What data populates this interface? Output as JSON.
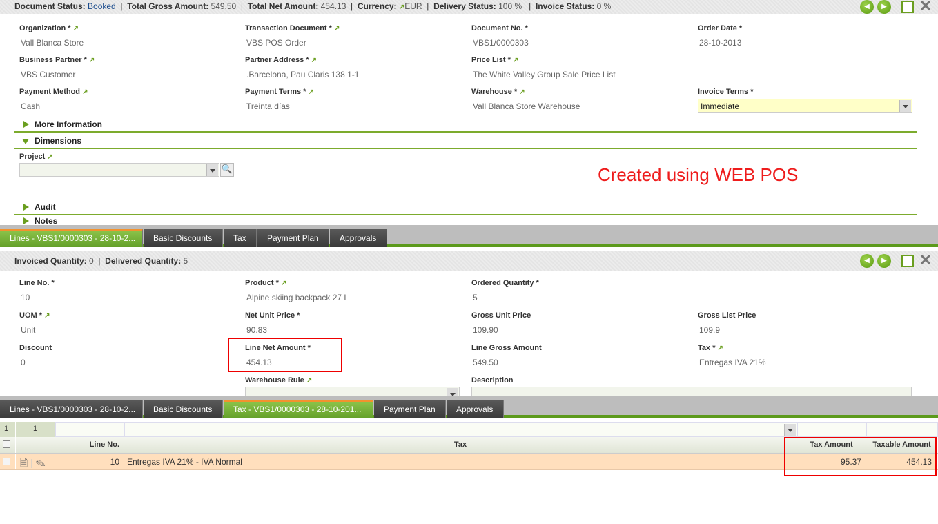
{
  "header": {
    "document_status_label": "Document Status:",
    "document_status": "Booked",
    "total_gross_label": "Total Gross Amount:",
    "total_gross": "549.50",
    "total_net_label": "Total Net Amount:",
    "total_net": "454.13",
    "currency_label": "Currency:",
    "currency": "EUR",
    "delivery_label": "Delivery Status:",
    "delivery": "100 %",
    "invoice_label": "Invoice Status:",
    "invoice": "0 %"
  },
  "form": {
    "organization": {
      "label": "Organization *",
      "value": "Vall Blanca Store"
    },
    "transaction_document": {
      "label": "Transaction Document *",
      "value": "VBS POS Order"
    },
    "document_no": {
      "label": "Document No. *",
      "value": "VBS1/0000303"
    },
    "order_date": {
      "label": "Order Date *",
      "value": "28-10-2013"
    },
    "business_partner": {
      "label": "Business Partner *",
      "value": "VBS Customer"
    },
    "partner_address": {
      "label": "Partner Address *",
      "value": ".Barcelona, Pau Claris 138 1-1"
    },
    "price_list": {
      "label": "Price List *",
      "value": "The White Valley Group Sale Price List"
    },
    "payment_method": {
      "label": "Payment Method",
      "value": "Cash"
    },
    "payment_terms": {
      "label": "Payment Terms *",
      "value": "Treinta días"
    },
    "warehouse": {
      "label": "Warehouse *",
      "value": "Vall Blanca Store Warehouse"
    },
    "invoice_terms": {
      "label": "Invoice Terms *",
      "value": "Immediate"
    },
    "project": {
      "label": "Project",
      "value": ""
    }
  },
  "sections": {
    "more_info": "More Information",
    "dimensions": "Dimensions",
    "audit": "Audit",
    "notes": "Notes"
  },
  "annotation": "Created using WEB POS",
  "tabs1": [
    "Lines - VBS1/0000303 - 28-10-2...",
    "Basic Discounts",
    "Tax",
    "Payment Plan",
    "Approvals"
  ],
  "lines_status": {
    "invoiced_label": "Invoiced Quantity:",
    "invoiced": "0",
    "delivered_label": "Delivered Quantity:",
    "delivered": "5"
  },
  "line": {
    "line_no": {
      "label": "Line No. *",
      "value": "10"
    },
    "product": {
      "label": "Product *",
      "value": "Alpine skiing backpack 27 L"
    },
    "ordered_qty": {
      "label": "Ordered Quantity *",
      "value": "5"
    },
    "uom": {
      "label": "UOM *",
      "value": "Unit"
    },
    "net_unit_price": {
      "label": "Net Unit Price *",
      "value": "90.83"
    },
    "gross_unit_price": {
      "label": "Gross Unit Price",
      "value": "109.90"
    },
    "gross_list_price": {
      "label": "Gross List Price",
      "value": "109.9"
    },
    "discount": {
      "label": "Discount",
      "value": "0"
    },
    "line_net_amount": {
      "label": "Line Net Amount *",
      "value": "454.13"
    },
    "line_gross_amount": {
      "label": "Line Gross Amount",
      "value": "549.50"
    },
    "tax": {
      "label": "Tax *",
      "value": "Entregas IVA 21%"
    },
    "warehouse_rule": {
      "label": "Warehouse Rule",
      "value": ""
    },
    "description": {
      "label": "Description",
      "value": ""
    }
  },
  "tabs2": [
    "Lines - VBS1/0000303 - 28-10-2...",
    "Basic Discounts",
    "Tax - VBS1/0000303 - 28-10-201...",
    "Payment Plan",
    "Approvals"
  ],
  "grid": {
    "filter_count": "1",
    "filter_count2": "1",
    "headers": {
      "line_no": "Line No.",
      "tax": "Tax",
      "tax_amount": "Tax Amount",
      "taxable_amount": "Taxable Amount"
    },
    "rows": [
      {
        "line_no": "10",
        "tax": "Entregas IVA 21% - IVA Normal",
        "tax_amount": "95.37",
        "taxable_amount": "454.13"
      }
    ]
  }
}
